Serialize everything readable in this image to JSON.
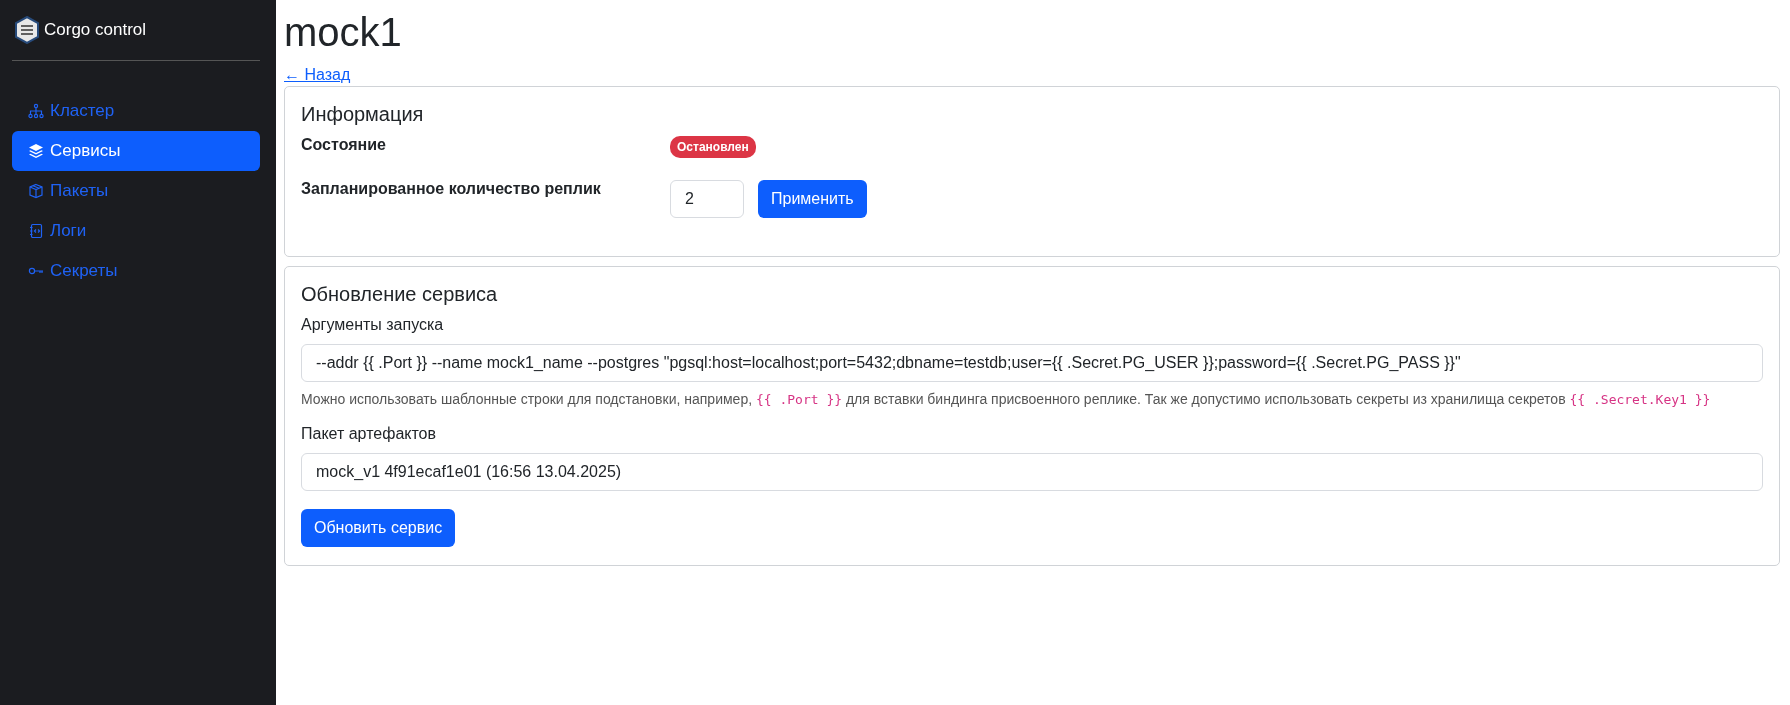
{
  "sidebar": {
    "brand": "Corgo control",
    "items": [
      {
        "label": "Кластер",
        "kind": "cluster",
        "selected": false
      },
      {
        "label": "Сервисы",
        "kind": "layers",
        "selected": true
      },
      {
        "label": "Пакеты",
        "kind": "box",
        "selected": false
      },
      {
        "label": "Логи",
        "kind": "journal",
        "selected": false
      },
      {
        "label": "Секреты",
        "kind": "key",
        "selected": false
      }
    ]
  },
  "page": {
    "title": "mock1",
    "back_link": "← Назад"
  },
  "info": {
    "title": "Информация",
    "status_label": "Состояние",
    "status": "Остановлен",
    "replicas_label": "Запланированное количество реплик",
    "replicas_value": "2",
    "apply_button": "Применить"
  },
  "update": {
    "title": "Обновление сервиса",
    "args_label": "Аргументы запуска",
    "args_value": "--addr {{ .Port }} --name mock1_name --postgres \"pgsql:host=localhost;port=5432;dbname=testdb;user={{ .Secret.PG_USER }};password={{ .Secret.PG_PASS }}\"",
    "hint": [
      {
        "kind": "text",
        "text": "Можно использовать шаблонные строки для подстановки, например, "
      },
      {
        "kind": "code",
        "text": "{{ .Port }}"
      },
      {
        "kind": "text",
        "text": " для вставки биндинга присвоенного реплике. Так же допустимо использовать секреты из хранилища секретов "
      },
      {
        "kind": "code",
        "text": "{{ .Secret.Key1 }}"
      }
    ],
    "package_label": "Пакет артефактов",
    "package_value": "mock_v1 4f91ecaf1e01 (16:56 13.04.2025)",
    "submit_button": "Обновить сервис"
  }
}
